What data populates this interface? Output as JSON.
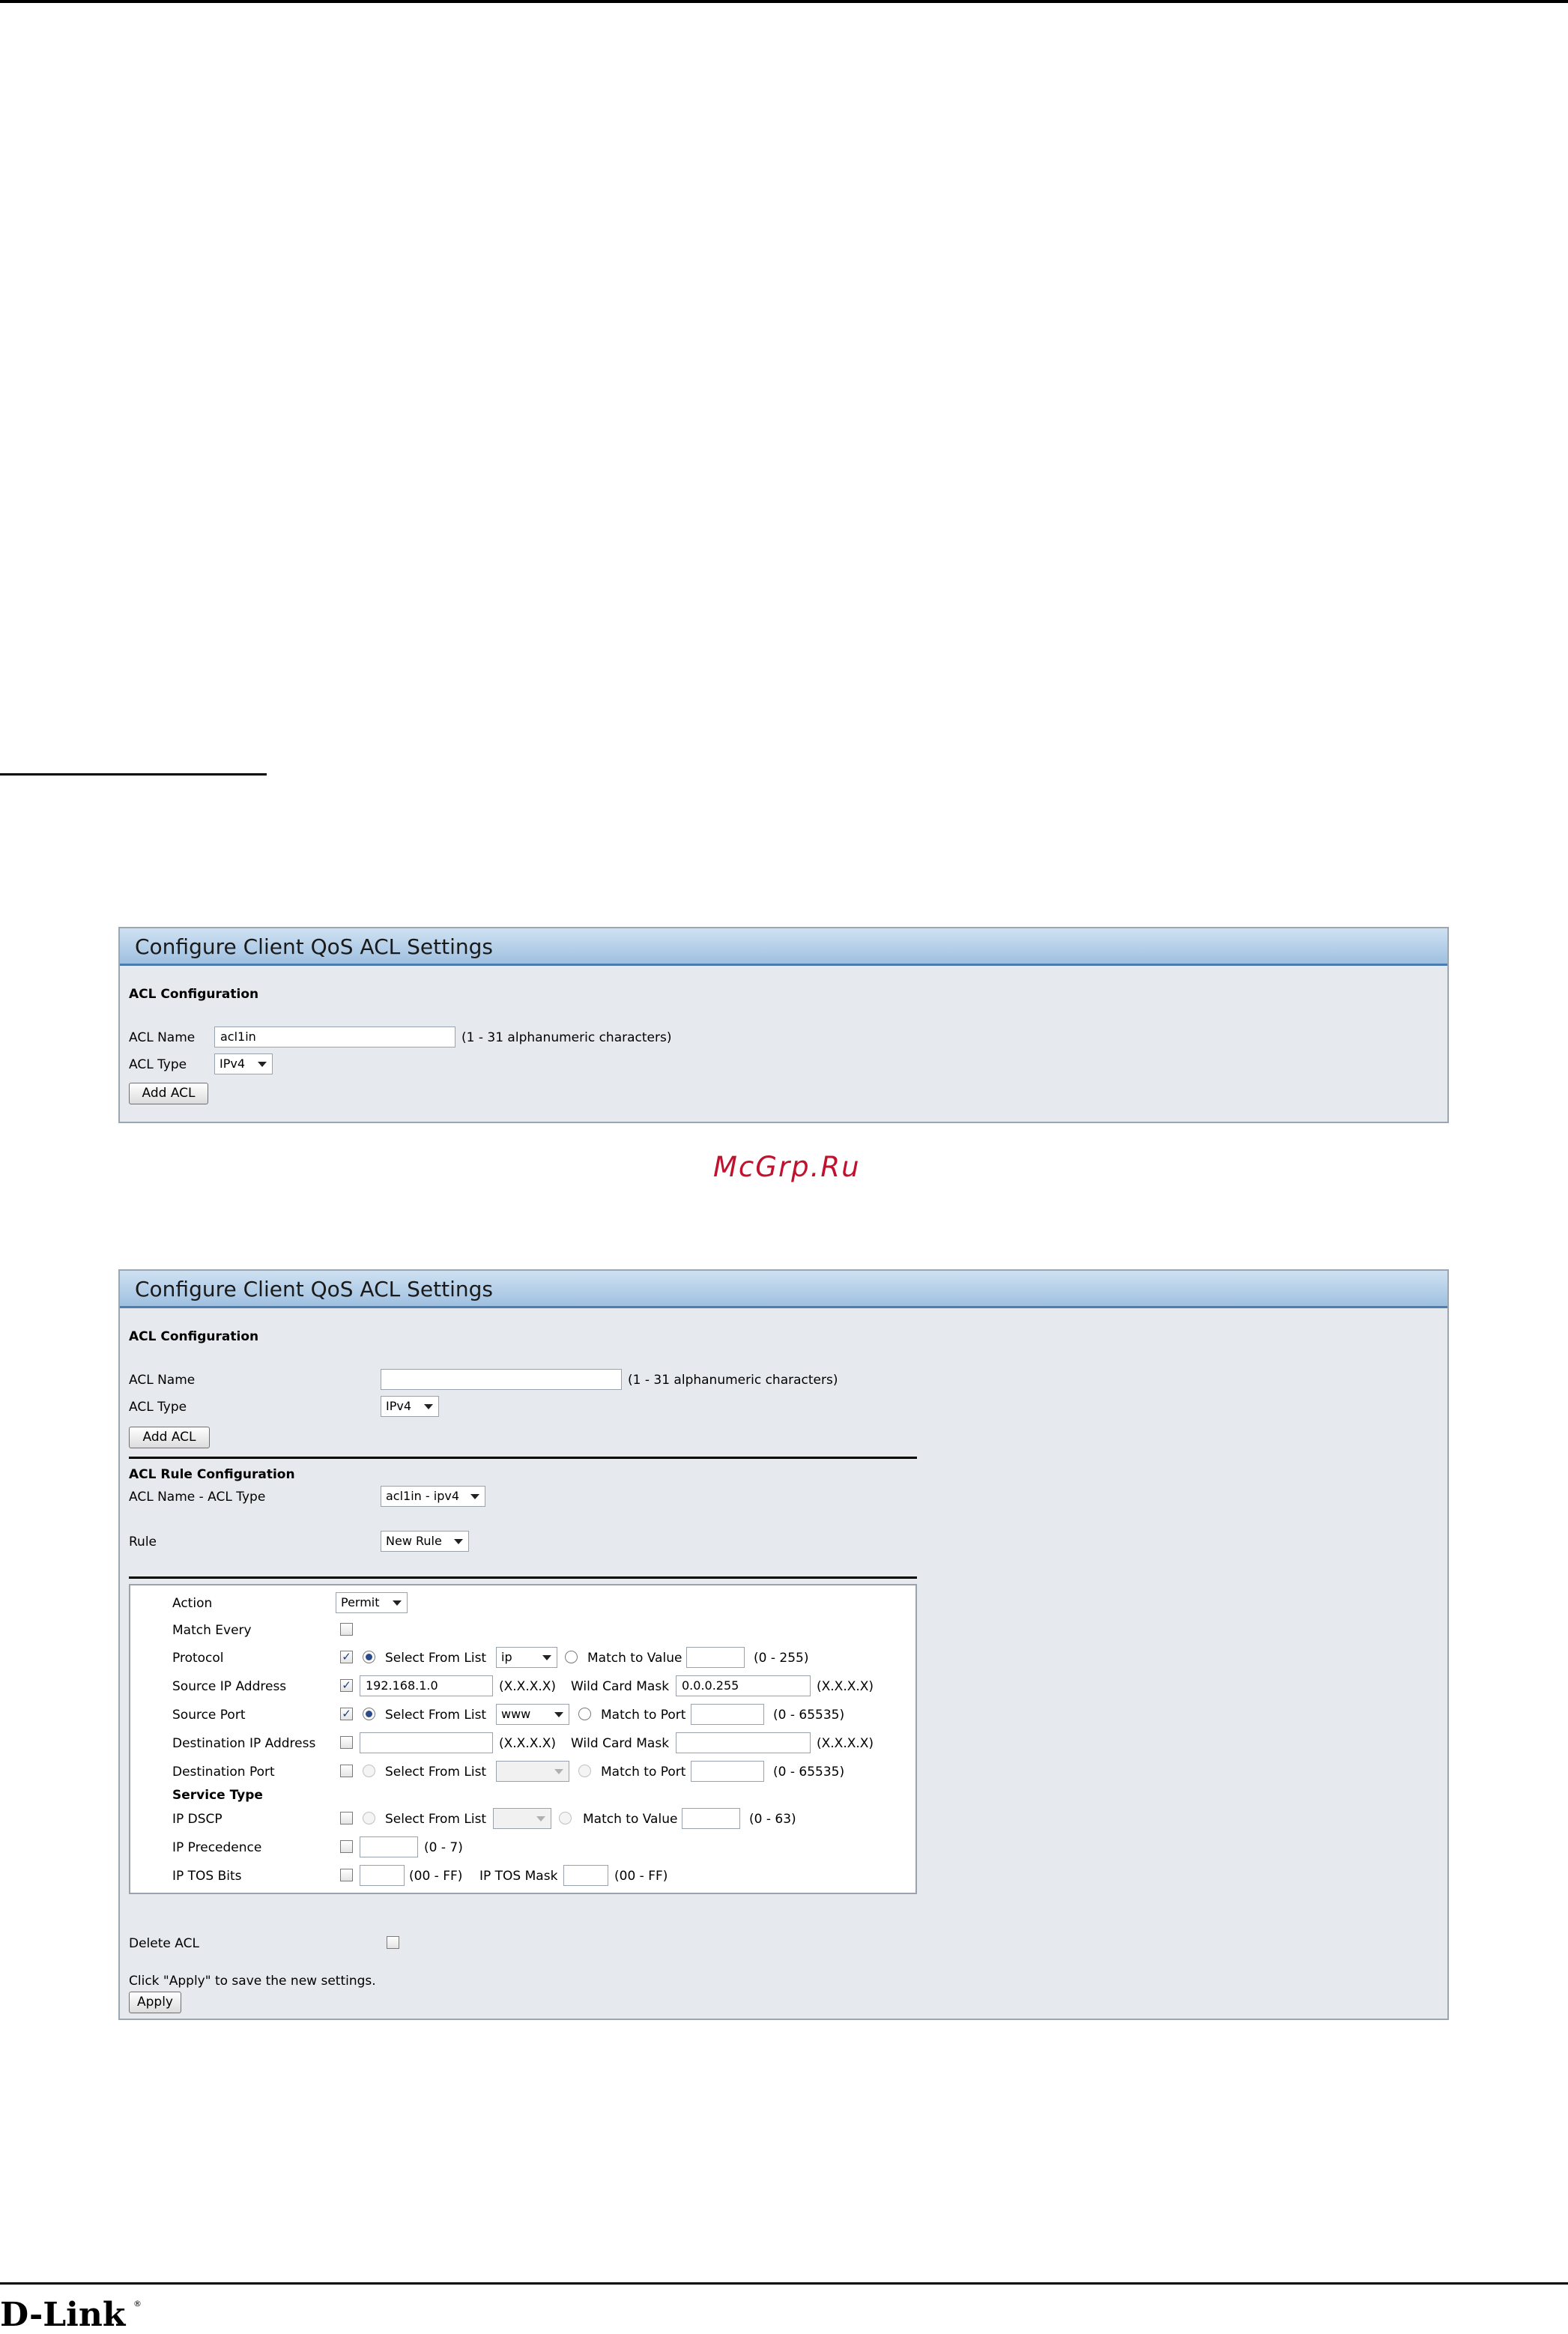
{
  "watermark": "McGrp.Ru",
  "brand": {
    "logo_text": "D-Link",
    "registered": "®"
  },
  "panel1": {
    "title": "Configure Client QoS ACL Settings",
    "section": "ACL Configuration",
    "acl_name_label": "ACL Name",
    "acl_name_value": "acl1in",
    "acl_name_hint": "(1 - 31 alphanumeric characters)",
    "acl_type_label": "ACL Type",
    "acl_type_value": "IPv4",
    "add_button": "Add ACL"
  },
  "panel2": {
    "title": "Configure Client QoS ACL Settings",
    "section": "ACL Configuration",
    "acl_name_label": "ACL Name",
    "acl_name_value": "",
    "acl_name_hint": "(1 - 31 alphanumeric characters)",
    "acl_type_label": "ACL Type",
    "acl_type_value": "IPv4",
    "add_button": "Add ACL",
    "rule_section": "ACL Rule Configuration",
    "name_type_label": "ACL Name - ACL Type",
    "name_type_value": "acl1in - ipv4",
    "rule_label": "Rule",
    "rule_value": "New Rule",
    "rule": {
      "action_label": "Action",
      "action_value": "Permit",
      "match_every_label": "Match Every",
      "protocol_label": "Protocol",
      "select_from_list": "Select From List",
      "protocol_list_value": "ip",
      "match_to_value": "Match to Value",
      "protocol_range": "(0 - 255)",
      "src_ip_label": "Source IP Address",
      "src_ip_value": "192.168.1.0",
      "ip_format": "(X.X.X.X)",
      "wildcard_label": "Wild Card Mask",
      "src_mask_value": "0.0.0.255",
      "src_port_label": "Source Port",
      "src_port_list_value": "www",
      "match_to_port": "Match to Port",
      "port_range": "(0 - 65535)",
      "dst_ip_label": "Destination IP Address",
      "dst_port_label": "Destination Port",
      "service_type_label": "Service Type",
      "ip_dscp_label": "IP DSCP",
      "dscp_range": "(0 - 63)",
      "ip_precedence_label": "IP Precedence",
      "precedence_range": "(0 - 7)",
      "ip_tos_label": "IP TOS Bits",
      "tos_range": "(00 - FF)",
      "tos_mask_label": "IP TOS Mask",
      "tos_mask_range": "(00 - FF)"
    },
    "delete_label": "Delete ACL",
    "apply_hint": "Click \"Apply\" to save the new settings.",
    "apply_button": "Apply"
  }
}
